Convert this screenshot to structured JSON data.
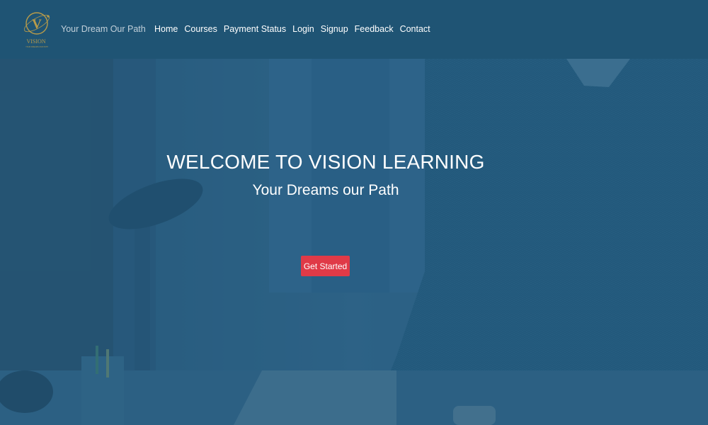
{
  "header": {
    "logo": {
      "name": "vision-logo",
      "letter": "V",
      "wordmark": "VISION",
      "fine_print": "YOUR DREAMS OUR PATH",
      "color": "#b89b4a"
    },
    "tagline": "Your Dream Our Path",
    "nav": [
      {
        "label": "Home"
      },
      {
        "label": "Courses"
      },
      {
        "label": "Payment Status"
      },
      {
        "label": "Login"
      },
      {
        "label": "Signup"
      },
      {
        "label": "Feedback"
      },
      {
        "label": "Contact"
      }
    ],
    "background_color": "#1f5474"
  },
  "hero": {
    "title": "WELCOME TO VISION LEARNING",
    "subtitle": "Your Dreams our Path",
    "cta_label": "Get Started",
    "cta_color": "#e03a47",
    "overlay_color": "#20587c",
    "background_image": "person-typing-on-laptop"
  }
}
